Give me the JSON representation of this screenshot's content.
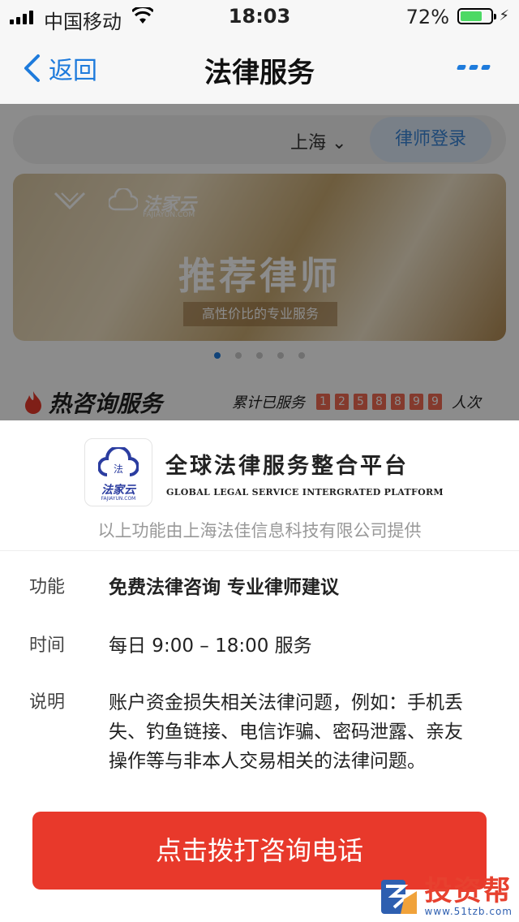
{
  "status_bar": {
    "carrier": "中国移动",
    "time": "18:03",
    "battery_pct": "72%",
    "battery_level": 0.72
  },
  "nav": {
    "back_label": "返回",
    "title": "法律服务"
  },
  "background": {
    "city": "上海",
    "login_label": "律师登录",
    "banner": {
      "brand": "法家云",
      "brand_sub": "FAJIAYUN.COM",
      "headline": "推荐律师",
      "subline": "高性价比的专业服务"
    },
    "carousel": {
      "count": 5,
      "active": 0
    },
    "hot_title": "热咨询服务",
    "served_prefix": "累计已服务",
    "served_digits": [
      "1",
      "2",
      "5",
      "8",
      "8",
      "9",
      "9"
    ],
    "served_suffix": "人次"
  },
  "provider": {
    "logo_char": "法",
    "logo_name": "法家云",
    "logo_url": "FAJIAYUN.COM",
    "title": "全球法律服务整合平台",
    "subtitle_en": "GLOBAL LEGAL SERVICE INTERGRATED PLATFORM",
    "provided_by": "以上功能由上海法佳信息科技有限公司提供"
  },
  "details": [
    {
      "key": "功能",
      "value": "免费法律咨询 专业律师建议"
    },
    {
      "key": "时间",
      "value": "每日 9:00 – 18:00 服务"
    },
    {
      "key": "说明",
      "value": "账户资金损失相关法律问题，例如：手机丢失、钓鱼链接、电信诈骗、密码泄露、亲友操作等与非本人交易相关的法律问题。"
    }
  ],
  "call_button": "点击拨打咨询电话",
  "watermark": {
    "name": "投资帮",
    "url": "www.51tzb.com"
  },
  "colors": {
    "accent": "#1e7bdc",
    "button": "#e8392b",
    "brand_blue": "#2b3da0"
  }
}
